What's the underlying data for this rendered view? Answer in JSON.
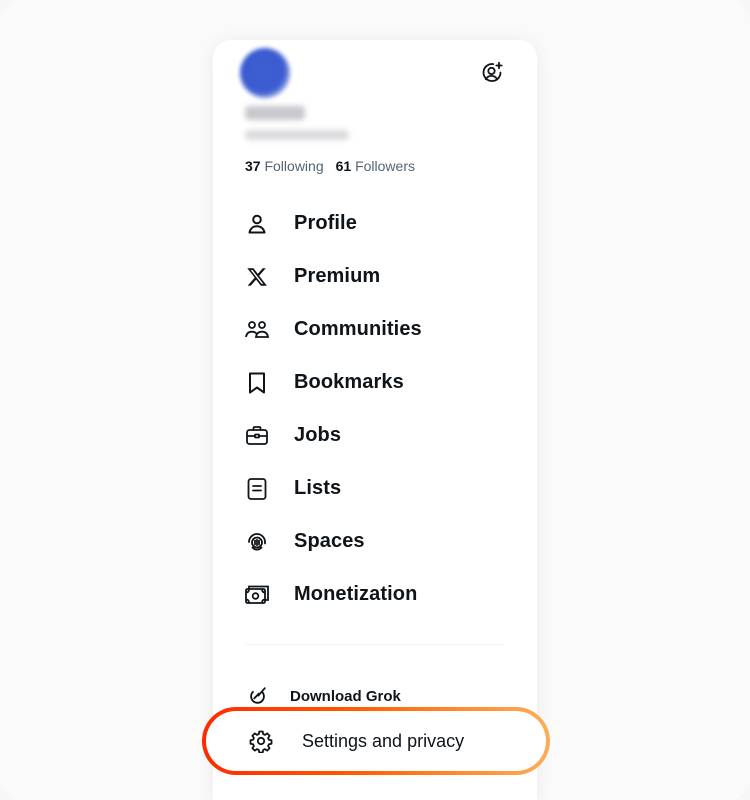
{
  "profile": {
    "following_count": "37",
    "following_label": "Following",
    "followers_count": "61",
    "followers_label": "Followers"
  },
  "menu": [
    {
      "label": "Profile",
      "icon": "person-icon"
    },
    {
      "label": "Premium",
      "icon": "x-logo-icon"
    },
    {
      "label": "Communities",
      "icon": "communities-icon"
    },
    {
      "label": "Bookmarks",
      "icon": "bookmark-icon"
    },
    {
      "label": "Jobs",
      "icon": "briefcase-icon"
    },
    {
      "label": "Lists",
      "icon": "list-icon"
    },
    {
      "label": "Spaces",
      "icon": "spaces-icon"
    },
    {
      "label": "Monetization",
      "icon": "money-icon"
    }
  ],
  "footer": {
    "grok_label": "Download Grok",
    "settings_label": "Settings and privacy"
  },
  "colors": {
    "text": "#0f1419",
    "muted": "#536471",
    "highlight_start": "#ff2a00",
    "highlight_end": "#fcae5a"
  }
}
